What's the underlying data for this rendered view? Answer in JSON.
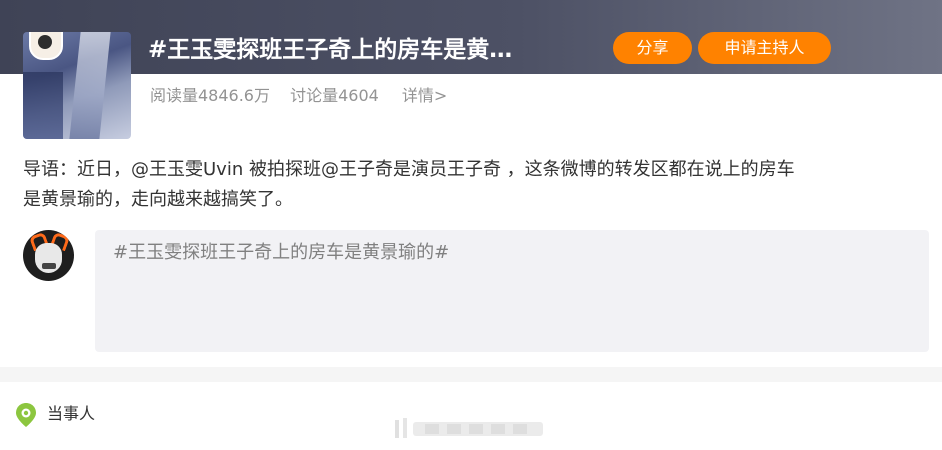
{
  "topic": {
    "title": "#王玉雯探班王子奇上的房车是黄…",
    "share_label": "分享",
    "host_label": "申请主持人"
  },
  "stats": {
    "read": "阅读量4846.6万",
    "discuss": "讨论量4604",
    "detail": "详情>"
  },
  "intro": {
    "line1": "导语：近日，@王玉雯Uvin 被拍探班@王子奇是演员王子奇 ，这条微博的转发区都在说上的房车",
    "line2": "是黄景瑜的，走向越来越搞笑了。"
  },
  "comment": {
    "placeholder": "#王玉雯探班王子奇上的房车是黄景瑜的#"
  },
  "footer": {
    "party_label": "当事人"
  },
  "colors": {
    "accent": "#ff8200",
    "banner": "#4a4e62",
    "stats_text": "#939393",
    "pin": "#8cc63f"
  }
}
